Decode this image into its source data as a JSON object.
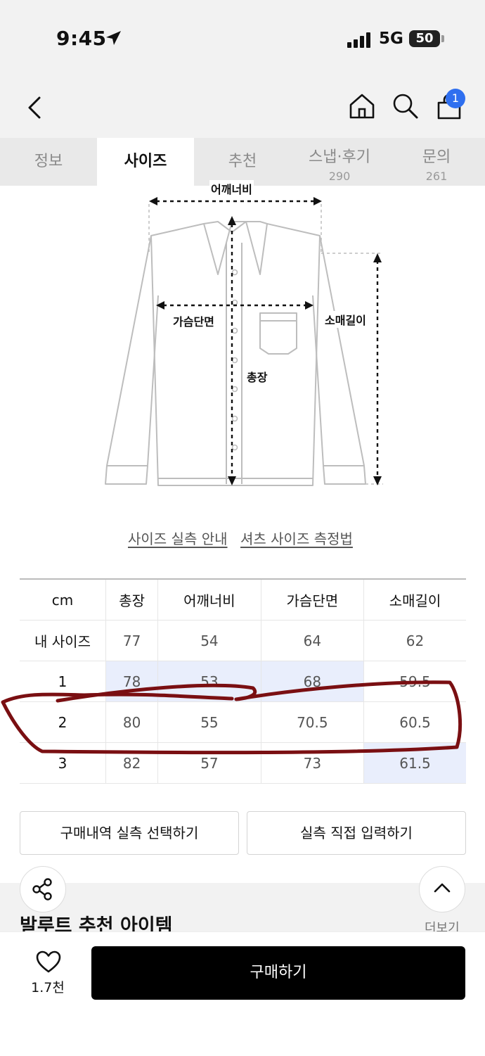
{
  "status": {
    "time": "9:45",
    "network": "5G",
    "battery": "50",
    "battery_level": 0.5
  },
  "nav": {
    "cart_badge": "1"
  },
  "tabs": [
    {
      "label": "정보"
    },
    {
      "label": "사이즈"
    },
    {
      "label": "추천"
    },
    {
      "label": "스냅·후기",
      "count": "290"
    },
    {
      "label": "문의",
      "count": "261"
    }
  ],
  "diagram": {
    "shoulder_label": "어깨너비",
    "chest_label": "가슴단면",
    "length_label": "총장",
    "sleeve_label": "소매길이"
  },
  "links": {
    "size_guide": "사이즈 실측 안내",
    "shirt_measure": "셔츠 사이즈 측정법"
  },
  "size_table": {
    "headers": [
      "cm",
      "총장",
      "어깨너비",
      "가슴단면",
      "소매길이"
    ],
    "rows": [
      [
        "내 사이즈",
        "77",
        "54",
        "64",
        "62"
      ],
      [
        "1",
        "78",
        "53",
        "68",
        "59.5"
      ],
      [
        "2",
        "80",
        "55",
        "70.5",
        "60.5"
      ],
      [
        "3",
        "82",
        "57",
        "73",
        "61.5"
      ]
    ]
  },
  "buttons": {
    "purchase_history": "구매내역 실측 선택하기",
    "manual_input": "실측 직접 입력하기"
  },
  "recommend": {
    "title": "발루트 추천 아이템",
    "more": "더보기"
  },
  "bottom": {
    "likes": "1.7천",
    "buy": "구매하기"
  },
  "colors": {
    "highlight": "#e9eefc",
    "annotation": "#7a0f12",
    "badge": "#2f6fef"
  }
}
